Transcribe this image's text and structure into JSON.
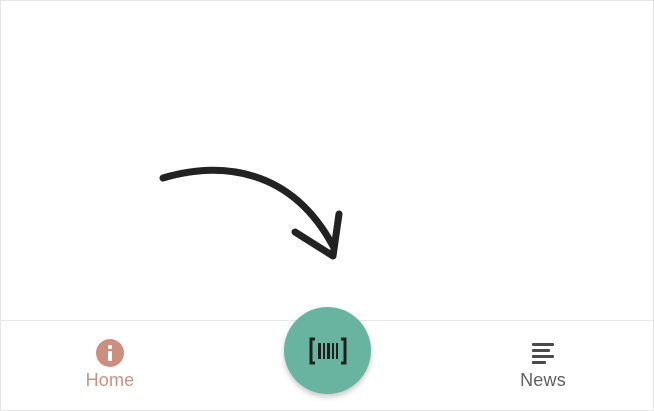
{
  "bottom_nav": {
    "items": [
      {
        "label": "Home",
        "icon": "info-icon",
        "active": true,
        "color": "#cc8f7f"
      },
      {
        "label": "News",
        "icon": "news-icon",
        "active": false,
        "color": "#5f5f5f"
      }
    ]
  },
  "fab": {
    "icon": "barcode-scan-icon",
    "color": "#68b4a0"
  },
  "annotation": {
    "icon": "curved-arrow-icon"
  }
}
